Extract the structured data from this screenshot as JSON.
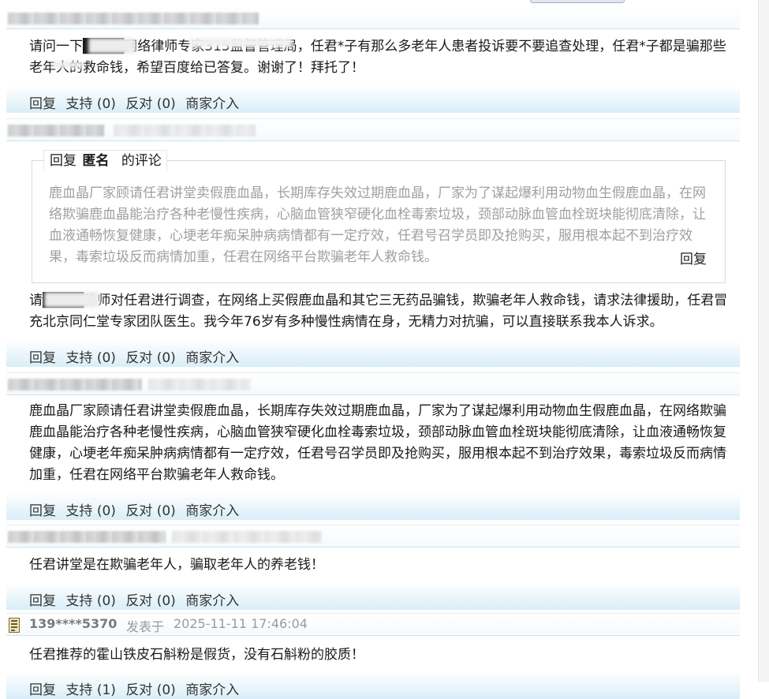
{
  "actions": {
    "reply": "回复",
    "support": "支持",
    "oppose": "反对",
    "merchant": "商家介入"
  },
  "comments": [
    {
      "text": "请问一下████网络律师专家315监督管理局，任君*子有那么多老年人患者投诉要不要追查处理，任君*子都是骗那些老年人的救命钱，希望百度给已答复。谢谢了！拜托了！",
      "support_count": "(0)",
      "oppose_count": "(0)"
    },
    {
      "quote": {
        "prefix": "回复",
        "author": "匿名",
        "suffix": "的评论",
        "text": "鹿血晶厂家顾请任君讲堂卖假鹿血晶，长期库存失效过期鹿血晶，厂家为了谋起爆利用动物血生假鹿血晶，在网络欺骗鹿血晶能治疗各种老慢性疾病，心脑血管狭窄硬化血栓毒索垃圾，颈部动脉血管血栓斑块能彻底清除，让血液通畅恢复健康，心埂老年痴呆肿病病情都有一定疗效，任君号召学员即及抢购买，服用根本起不到治疗效果，毒索垃圾反而病情加重，任君在网络平台欺骗老年人救命钱。",
        "reply": "回复"
      },
      "text": "请████律师对任君进行调查，在网络上买假鹿血晶和其它三无药品骗钱，欺骗老年人救命钱，请求法律援助，任君冒充北京同仁堂专家团队医生。我今年76岁有多种慢性病情在身，无精力对抗骗，可以直接联系我本人诉求。",
      "support_count": "(0)",
      "oppose_count": "(0)"
    },
    {
      "text": "鹿血晶厂家顾请任君讲堂卖假鹿血晶，长期库存失效过期鹿血晶，厂家为了谋起爆利用动物血生假鹿血晶，在网络欺骗鹿血晶能治疗各种老慢性疾病，心脑血管狭窄硬化血栓毒索垃圾，颈部动脉血管血栓斑块能彻底清除，让血液通畅恢复健康，心埂老年痴呆肿病病情都有一定疗效，任君号召学员即及抢购买，服用根本起不到治疗效果，毒索垃圾反而病情加重，任君在网络平台欺骗老年人救命钱。",
      "support_count": "(0)",
      "oppose_count": "(0)"
    },
    {
      "text": "任君讲堂是在欺骗老年人，骗取老年人的养老钱！",
      "support_count": "(0)",
      "oppose_count": "(0)"
    },
    {
      "username": "139****5370",
      "posted_label": "发表于",
      "posted_time": "2025-11-11 17:46:04",
      "text": "任君推荐的霍山铁皮石斛粉是假货，没有石斛粉的胶质！",
      "support_count": "(1)",
      "oppose_count": "(0)"
    }
  ]
}
